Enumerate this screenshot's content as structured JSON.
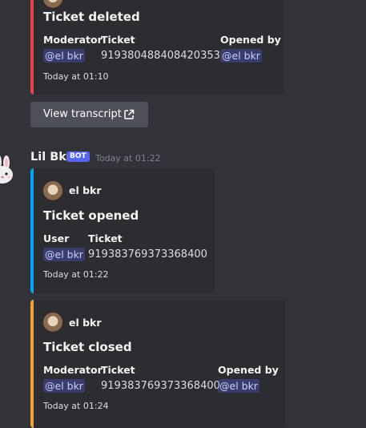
{
  "embed_deleted": {
    "title": "Ticket deleted",
    "fields": [
      {
        "name": "Moderator",
        "value": "@el bkr",
        "mention": true
      },
      {
        "name": "Ticket",
        "value": "919380488408420353",
        "mention": false
      },
      {
        "name": "Opened by",
        "value": "@el bkr",
        "mention": true
      }
    ],
    "footer": "Today at 01:10",
    "accent": "#ed4245"
  },
  "transcript_button": {
    "label": "View transcript",
    "icon": "external-link-icon"
  },
  "message": {
    "author": "Lil Bkr",
    "bot_tag": "BOT",
    "timestamp": "Today at 01:22",
    "avatar_icon": "bunny-avatar-icon"
  },
  "embed_opened": {
    "author": "el bkr",
    "title": "Ticket opened",
    "fields": [
      {
        "name": "User",
        "value": "@el bkr",
        "mention": true
      },
      {
        "name": "Ticket",
        "value": "919383769373368400",
        "mention": false
      }
    ],
    "footer": "Today at 01:22",
    "accent": "#00a8fc"
  },
  "embed_closed": {
    "author": "el bkr",
    "title": "Ticket closed",
    "fields": [
      {
        "name": "Moderator",
        "value": "@el bkr",
        "mention": true
      },
      {
        "name": "Ticket",
        "value": "919383769373368400",
        "mention": false
      },
      {
        "name": "Opened by",
        "value": "@el bkr",
        "mention": true
      }
    ],
    "footer": "Today at 01:24",
    "accent": "#f0a232"
  }
}
